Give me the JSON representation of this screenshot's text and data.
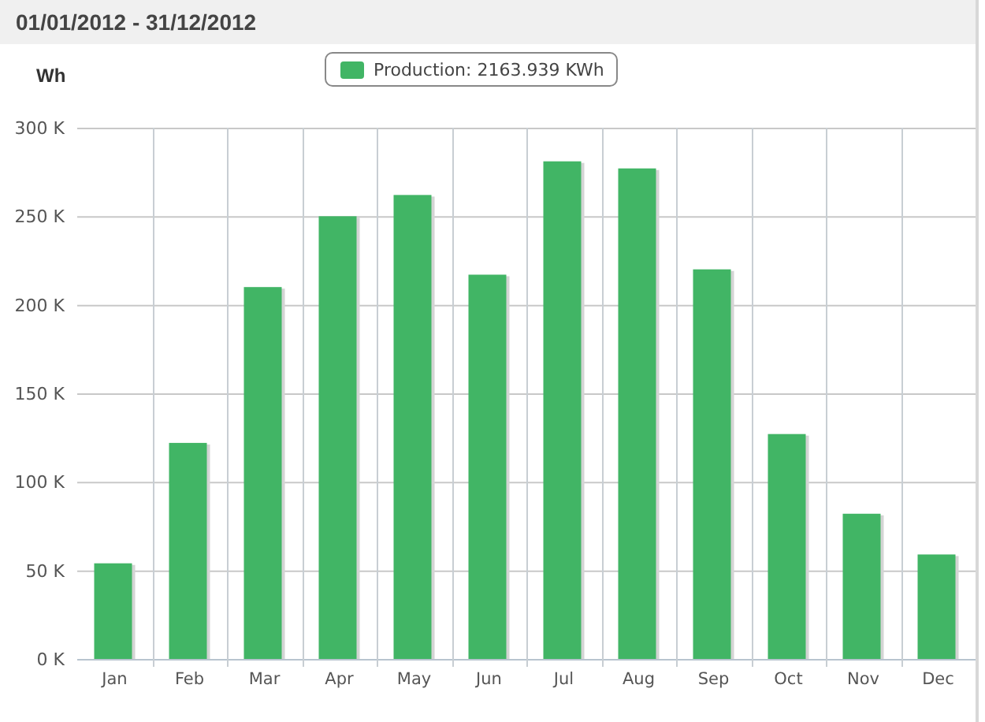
{
  "header": {
    "title": "01/01/2012 - 31/12/2012"
  },
  "chart": {
    "chart_data": {
      "type": "bar",
      "ylabel": "Wh",
      "grid": true,
      "categories": [
        "Jan",
        "Feb",
        "Mar",
        "Apr",
        "May",
        "Jun",
        "Jul",
        "Aug",
        "Sep",
        "Oct",
        "Nov",
        "Dec"
      ],
      "series": [
        {
          "name": "Production: 2163.939 KWh",
          "color": "#41b565",
          "values": [
            54000,
            122000,
            210000,
            250000,
            262000,
            217000,
            281000,
            277000,
            220000,
            127000,
            82000,
            59000
          ]
        }
      ],
      "ylim": [
        0,
        300000
      ],
      "yticks": [
        {
          "value": 0,
          "label": "0 K"
        },
        {
          "value": 50000,
          "label": "50 K"
        },
        {
          "value": 100000,
          "label": "100 K"
        },
        {
          "value": 150000,
          "label": "150 K"
        },
        {
          "value": 200000,
          "label": "200 K"
        },
        {
          "value": 250000,
          "label": "250 K"
        },
        {
          "value": 300000,
          "label": "300 K"
        }
      ]
    }
  }
}
